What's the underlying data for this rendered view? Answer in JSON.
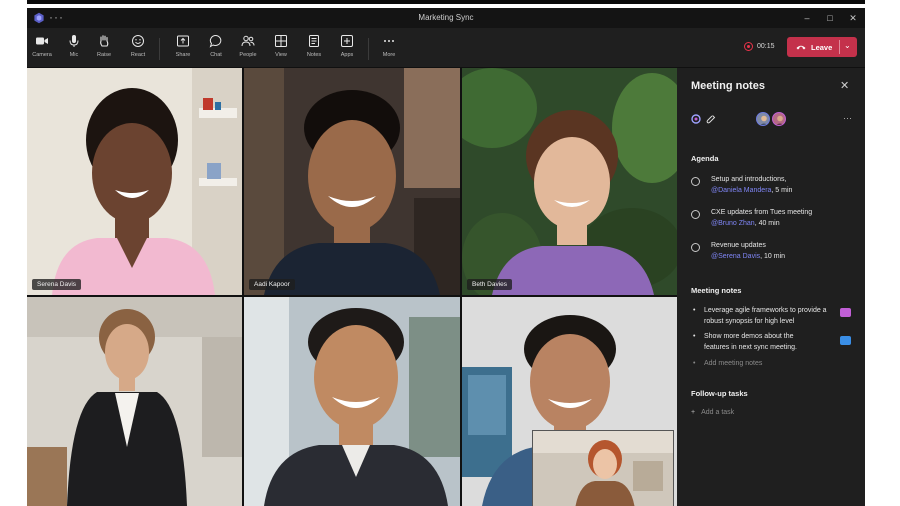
{
  "window": {
    "title": "Marketing Sync",
    "more_label": "···",
    "minimize_glyph": "–",
    "maximize_glyph": "□",
    "close_glyph": "✕"
  },
  "toolbar": {
    "items": [
      {
        "icon": "camera-icon",
        "label": "Camera"
      },
      {
        "icon": "mic-icon",
        "label": "Mic"
      },
      {
        "icon": "raise-hand-icon",
        "label": "Raise"
      },
      {
        "icon": "react-icon",
        "label": "React"
      },
      {
        "icon": "share-icon",
        "label": "Share"
      },
      {
        "icon": "chat-icon",
        "label": "Chat"
      },
      {
        "icon": "people-icon",
        "label": "People"
      },
      {
        "icon": "view-icon",
        "label": "View"
      },
      {
        "icon": "notes-icon",
        "label": "Notes"
      },
      {
        "icon": "apps-icon",
        "label": "Apps"
      },
      {
        "icon": "more-icon",
        "label": "More"
      }
    ],
    "recording_time": "00:15",
    "leave_label": "Leave",
    "leave_chevron": "⌄"
  },
  "participants": [
    {
      "name": "Serena Davis"
    },
    {
      "name": "Aadi Kapoor"
    },
    {
      "name": "Beth Davies"
    },
    {
      "name": ""
    },
    {
      "name": ""
    },
    {
      "name": ""
    }
  ],
  "notes_panel": {
    "title": "Meeting notes",
    "close_glyph": "✕",
    "more_glyph": "···",
    "agenda_heading": "Agenda",
    "agenda": [
      {
        "text": "Setup and introductions,",
        "mention": "@Daniela Mandera",
        "suffix": ", 5 min"
      },
      {
        "text": "CXE updates from Tues meeting",
        "mention": "@Bruno Zhan",
        "suffix": ", 40 min"
      },
      {
        "text": "Revenue updates",
        "mention": "@Serena Davis",
        "suffix": ", 10 min"
      }
    ],
    "notes_heading": "Meeting notes",
    "notes": [
      {
        "line1": "Leverage agile frameworks to provide a",
        "line2": "robust synopsis for high level"
      },
      {
        "line1": "Show more demos about the",
        "line2": "features in next sync meeting."
      }
    ],
    "add_notes_placeholder": "Add meeting notes",
    "tasks_heading": "Follow-up tasks",
    "add_task_label": "Add a task",
    "bullet_glyph": "•",
    "plus_glyph": "+"
  },
  "colors": {
    "accent": "#7f85f5",
    "leave": "#c4314b",
    "background": "#1f1f1f"
  }
}
